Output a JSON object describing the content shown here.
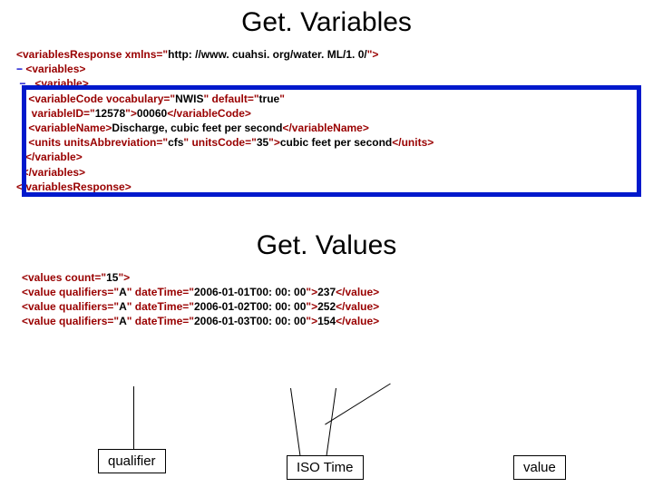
{
  "titles": {
    "get_variables": "Get. Variables",
    "get_values": "Get. Values"
  },
  "xml1": {
    "l1_a": "<variablesResponse ",
    "l1_b": "xmlns",
    "l1_c": "=\"",
    "l1_d": "http: //www. cuahsi. org/water. ML/1. 0/",
    "l1_e": "\">",
    "l2": " <variables>",
    "l3": "   <variable>",
    "l4_a": "    <variableCode ",
    "l4_b": "vocabulary",
    "l4_c": "=\"",
    "l4_d": "NWIS",
    "l4_e": "\" ",
    "l4_f": "default",
    "l4_g": "=\"",
    "l4_h": "true",
    "l4_i": "\"",
    "l5_a": "     ",
    "l5_b": "variableID",
    "l5_c": "=\"",
    "l5_d": "12578",
    "l5_e": "\">",
    "l5_f": "00060",
    "l5_g": "</variableCode>",
    "l6_a": "    <variableName>",
    "l6_b": "Discharge, cubic feet per second",
    "l6_c": "</variableName>",
    "l7_a": "    <units ",
    "l7_b": "unitsAbbreviation",
    "l7_c": "=\"",
    "l7_d": "cfs",
    "l7_e": "\" ",
    "l7_f": "unitsCode",
    "l7_g": "=\"",
    "l7_h": "35",
    "l7_i": "\">",
    "l7_j": "cubic feet per second",
    "l7_k": "</units>",
    "l8": "   </variable>",
    "l9": "  </variables>",
    "l10": "</variablesResponse>"
  },
  "xml2": {
    "l1_a": "<values ",
    "l1_b": "count",
    "l1_c": "=\"",
    "l1_d": "15",
    "l1_e": "\">",
    "l2_a": "<value ",
    "l2_b": "qualifiers",
    "l2_c": "=\"",
    "l2_d": "A",
    "l2_e": "\" ",
    "l2_f": "dateTime",
    "l2_g": "=\"",
    "l2_h": "2006-01-01T00: 00: 00",
    "l2_i": "\">",
    "l2_j": "237",
    "l2_k": "</value>",
    "l3_a": "<value ",
    "l3_b": "qualifiers",
    "l3_c": "=\"",
    "l3_d": "A",
    "l3_e": "\" ",
    "l3_f": "dateTime",
    "l3_g": "=\"",
    "l3_h": "2006-01-02T00: 00: 00",
    "l3_i": "\">",
    "l3_j": "252",
    "l3_k": "</value>",
    "l4_a": "<value ",
    "l4_b": "qualifiers",
    "l4_c": "=\"",
    "l4_d": "A",
    "l4_e": "\" ",
    "l4_f": "dateTime",
    "l4_g": "=\"",
    "l4_h": "2006-01-03T00: 00: 00",
    "l4_i": "\">",
    "l4_j": "154",
    "l4_k": "</value>"
  },
  "labels": {
    "qualifier": "qualifier",
    "iso_time": "ISO Time",
    "value": "value"
  },
  "sym": {
    "minus": "−"
  }
}
